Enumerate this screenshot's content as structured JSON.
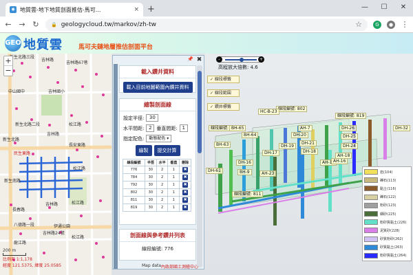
{
  "browser": {
    "tab_title": "地質雲-地下地質剖面推估-馬可...",
    "tab_close": "×",
    "new_tab": "+",
    "url": "geologycloud.tw/markov/zh-tw",
    "win_min": "—",
    "win_max": "☐",
    "win_close": "✕",
    "nav_back": "←",
    "nav_forward": "→",
    "nav_reload": "↻",
    "secure": "🔒",
    "star": "☆",
    "menu": "⋮",
    "ext_label": "G"
  },
  "banner": {
    "logo_mark": "GEO",
    "logo_text": "地質雲",
    "subtitle": "馬可夫鏈地層推估剖面平台"
  },
  "map": {
    "zoom_in": "+",
    "zoom_out": "−",
    "scale_label": "200 m",
    "scale_text": "比例尺 1:1,178",
    "coords": "經度 121.5375, 緯度 25.0585",
    "labels": [
      "新生北路三段",
      "吉林路",
      "吉林路67巷",
      "中山國中",
      "吉林國小",
      "新生北路二段",
      "松江路",
      "吉林路",
      "新生北路",
      "長安東路",
      "民生東路",
      "松江路",
      "吉林路",
      "松江路",
      "長春路",
      "新生南路",
      "八德路一段",
      "伊通公園",
      "吉林路24號",
      "松江路",
      "龍江路"
    ]
  },
  "panel": {
    "pin": "📌",
    "close": "✖",
    "load_title": "載入鑽井資料",
    "load_button": "載入目前地圖範圍內鑽井資料",
    "draw_title": "繪製剖面線",
    "section_height_label": "設定半徑:",
    "section_height_value": "30",
    "h_sep_label": "水平間距:",
    "h_sep_value": "2",
    "v_sep_label": "垂直間距:",
    "v_sep_value": "1",
    "color_label": "指定配色:",
    "color_value": "動態配色 ▾",
    "draw_button": "繪製",
    "submit_button": "提交計算",
    "table_headers": [
      "線段編號",
      "半徑",
      "水平",
      "垂直",
      "刪除"
    ],
    "table_rows": [
      [
        "776",
        "30",
        "2",
        "1",
        "✖"
      ],
      [
        "784",
        "30",
        "2",
        "1",
        "✖"
      ],
      [
        "792",
        "30",
        "2",
        "1",
        "✖"
      ],
      [
        "802",
        "30",
        "2",
        "1",
        "✖"
      ],
      [
        "811",
        "30",
        "2",
        "1",
        "✖"
      ],
      [
        "819",
        "30",
        "2",
        "1",
        "✖"
      ]
    ],
    "ref_title": "剖面線與參考鑽井列表",
    "ref_line": "線段編號: 776",
    "footer_left": "Map data",
    "footer_right": "內政部國土測繪中心"
  },
  "view3d": {
    "slider_minus": "-",
    "slider_plus": "+",
    "ratio_text": "高程放大倍數: 4.6",
    "toggles": [
      "✓ 線段標籤",
      "✓ 線段範圍",
      "✓ 鑽井標籤"
    ],
    "section_labels": [
      "線段編號: 802",
      "線段編號: 776",
      "線段編號: 819",
      "線段編號: 811"
    ],
    "bh_labels": [
      "HC-B-23",
      "BH-65",
      "BH-64",
      "BH-63",
      "AH-7",
      "DH-20",
      "DH-19",
      "DH-21",
      "DH-26",
      "DH-25",
      "DH-24",
      "DH-32",
      "DH-18",
      "DH-17",
      "DH-16",
      "AH-17",
      "AH-16",
      "AH-18",
      "DH-61",
      "BH-9",
      "AH-23"
    ]
  },
  "legend": [
    {
      "name": "岩(104)",
      "color": "#f2df5a"
    },
    {
      "name": "礫石(113)",
      "color": "#c9b97d"
    },
    {
      "name": "黏土(116)",
      "color": "#8c5b2b"
    },
    {
      "name": "礫石(122)",
      "color": "#d6cfa3"
    },
    {
      "name": "粉砂(123)",
      "color": "#9f9f9f"
    },
    {
      "name": "細砂(225)",
      "color": "#4b6d3a"
    },
    {
      "name": "粉砂質黏土(226)",
      "color": "#63e0c8"
    },
    {
      "name": "泥質砂(228)",
      "color": "#d980e8"
    },
    {
      "name": "砂質粉砂(262)",
      "color": "#cfc1f2"
    },
    {
      "name": "砂質黏土(263)",
      "color": "#2f89d9"
    },
    {
      "name": "粉砂質黏土(264)",
      "color": "#2b2bff"
    }
  ]
}
